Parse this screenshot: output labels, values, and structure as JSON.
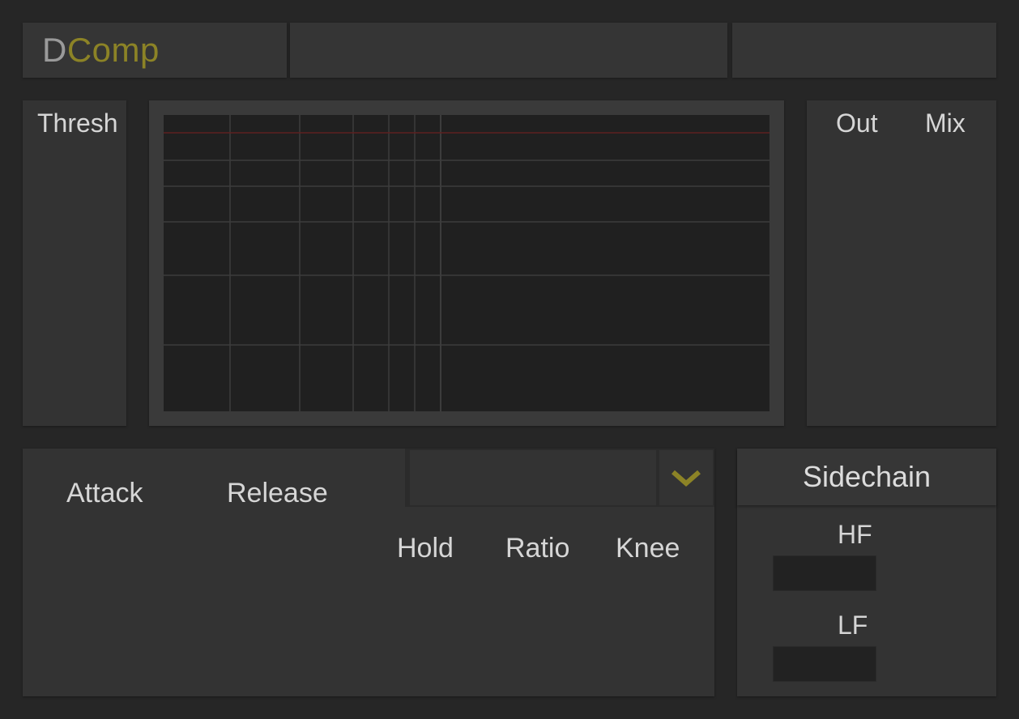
{
  "header": {
    "logo_prefix": "D",
    "logo_suffix": "Comp",
    "preset_value": "",
    "extra_value": ""
  },
  "threshold": {
    "label": "Thresh"
  },
  "output": {
    "out_label": "Out",
    "mix_label": "Mix"
  },
  "envelope": {
    "attack_label": "Attack",
    "release_label": "Release",
    "hold_label": "Hold",
    "ratio_label": "Ratio",
    "knee_label": "Knee",
    "mode_value": "",
    "dropdown_icon": "chevron-down-icon"
  },
  "sidechain": {
    "title": "Sidechain",
    "hf_label": "HF",
    "lf_label": "LF",
    "hf_value": "",
    "lf_value": ""
  },
  "colors": {
    "background": "#262626",
    "panel": "#333333",
    "accent": "#8c8326",
    "threshold_line": "#6e1e1e",
    "grid": "#3d3d3d"
  }
}
